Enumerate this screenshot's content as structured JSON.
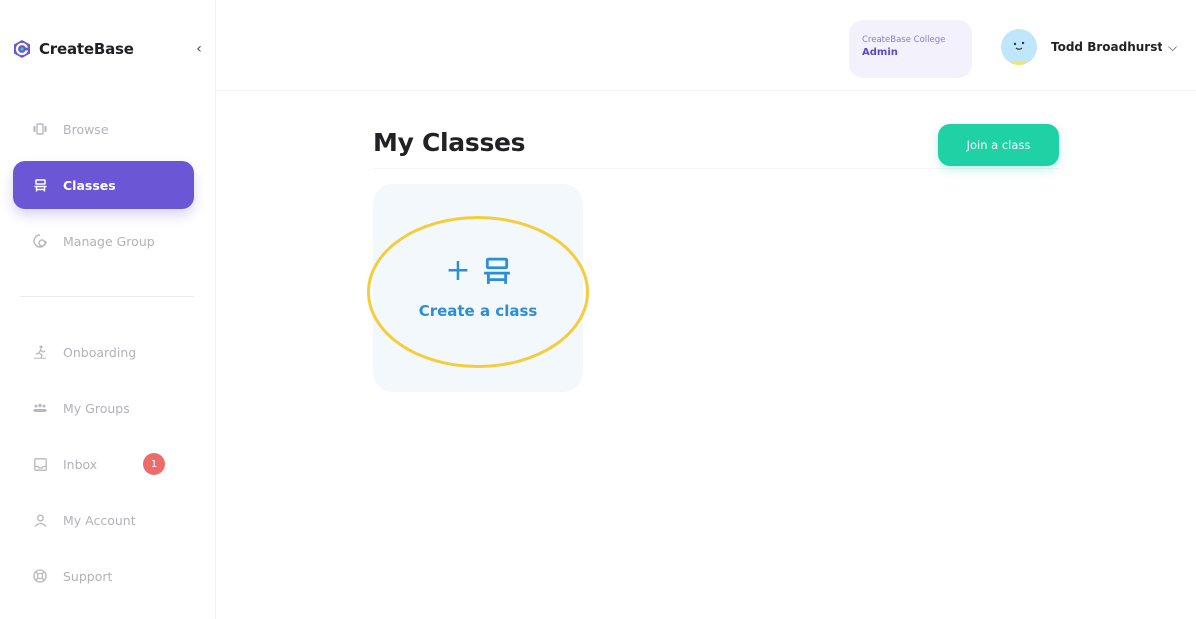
{
  "brand": {
    "name": "CreateBase",
    "collapse_icon": "chevron-left-icon"
  },
  "sidebar": {
    "items": [
      {
        "label": "Browse",
        "icon": "browse-icon",
        "active": false
      },
      {
        "label": "Classes",
        "icon": "classes-icon",
        "active": true
      },
      {
        "label": "Manage Group",
        "icon": "manage-group-icon",
        "active": false
      },
      {
        "label": "Onboarding",
        "icon": "onboarding-icon",
        "active": false
      },
      {
        "label": "My Groups",
        "icon": "groups-icon",
        "active": false
      },
      {
        "label": "Inbox",
        "icon": "inbox-icon",
        "active": false,
        "badge": "1"
      },
      {
        "label": "My Account",
        "icon": "account-icon",
        "active": false
      },
      {
        "label": "Support",
        "icon": "support-icon",
        "active": false
      }
    ]
  },
  "header": {
    "org": {
      "name": "CreateBase College",
      "role": "Admin"
    },
    "user": {
      "name": "Todd Broadhurst",
      "menu_icon": "chevron-down-icon"
    }
  },
  "main": {
    "title": "My Classes",
    "join_label": "Join a class",
    "create_card": {
      "label": "Create a class",
      "icons": [
        "plus-icon",
        "classes-icon"
      ]
    }
  },
  "colors": {
    "accent": "#6b57d6",
    "join_button": "#1fd2a6",
    "create_text": "#2b8fd8",
    "highlight_ring": "#f5cd3a",
    "badge": "#ee6b6b"
  }
}
